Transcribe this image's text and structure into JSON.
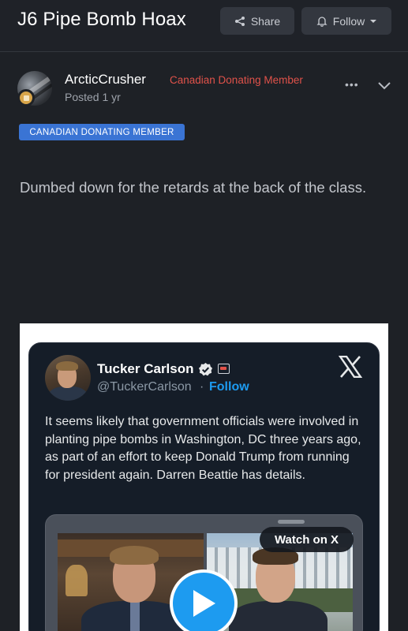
{
  "header": {
    "title": "J6 Pipe Bomb Hoax",
    "share_label": "Share",
    "follow_label": "Follow"
  },
  "post": {
    "author": "ArcticCrusher",
    "member_title": "Canadian Donating Member",
    "posted": "Posted 1 yr",
    "role_badge": "CANADIAN DONATING MEMBER",
    "body": "Dumbed down for the retards at the back of the class."
  },
  "tweet": {
    "author_name": "Tucker Carlson",
    "handle": "@TuckerCarlson",
    "separator": "·",
    "follow_label": "Follow",
    "text": "It seems likely that government officials were involved in planting pipe bombs in Washington, DC three years ago, as part of an effort to keep Donald Trump from running for president again. Darren Beattie has details.",
    "watch_label": "Watch on X"
  },
  "colors": {
    "background": "#1e2126",
    "accent_red": "#e0524a",
    "badge_blue": "#3a74d4",
    "x_blue": "#1d9bf0"
  }
}
